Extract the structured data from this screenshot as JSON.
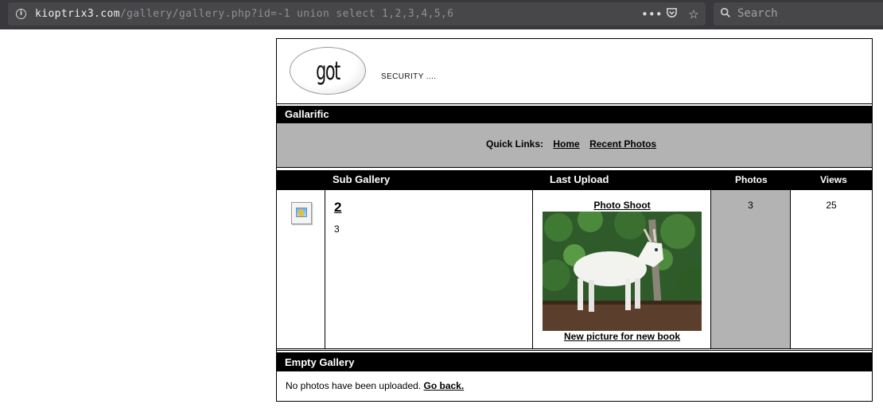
{
  "browser": {
    "url_host": "kioptrix3.com",
    "url_path": "/gallery/gallery.php?id=-1 union select 1,2,3,4,5,6",
    "search_placeholder": "Search",
    "icons": [
      "info-icon",
      "more-icon",
      "pocket-icon",
      "bookmark-star-icon",
      "search-icon"
    ]
  },
  "site": {
    "logo_text": "got goat?",
    "tagline": "SECURITY ...."
  },
  "gallery": {
    "title": "Gallarific",
    "quick_links_label": "Quick Links:",
    "quick_links": [
      "Home",
      "Recent Photos"
    ]
  },
  "table": {
    "headers": {
      "sub_gallery": "Sub Gallery",
      "last_upload": "Last Upload",
      "photos": "Photos",
      "views": "Views"
    },
    "row": {
      "sub_gallery_name": "2",
      "sub_gallery_value": "3",
      "photo_title": "Photo Shoot",
      "photo_caption": "New picture for new book",
      "photos": "3",
      "views": "25"
    }
  },
  "empty_gallery": {
    "title": "Empty Gallery",
    "message": "No photos have been uploaded.",
    "link": "Go back."
  }
}
